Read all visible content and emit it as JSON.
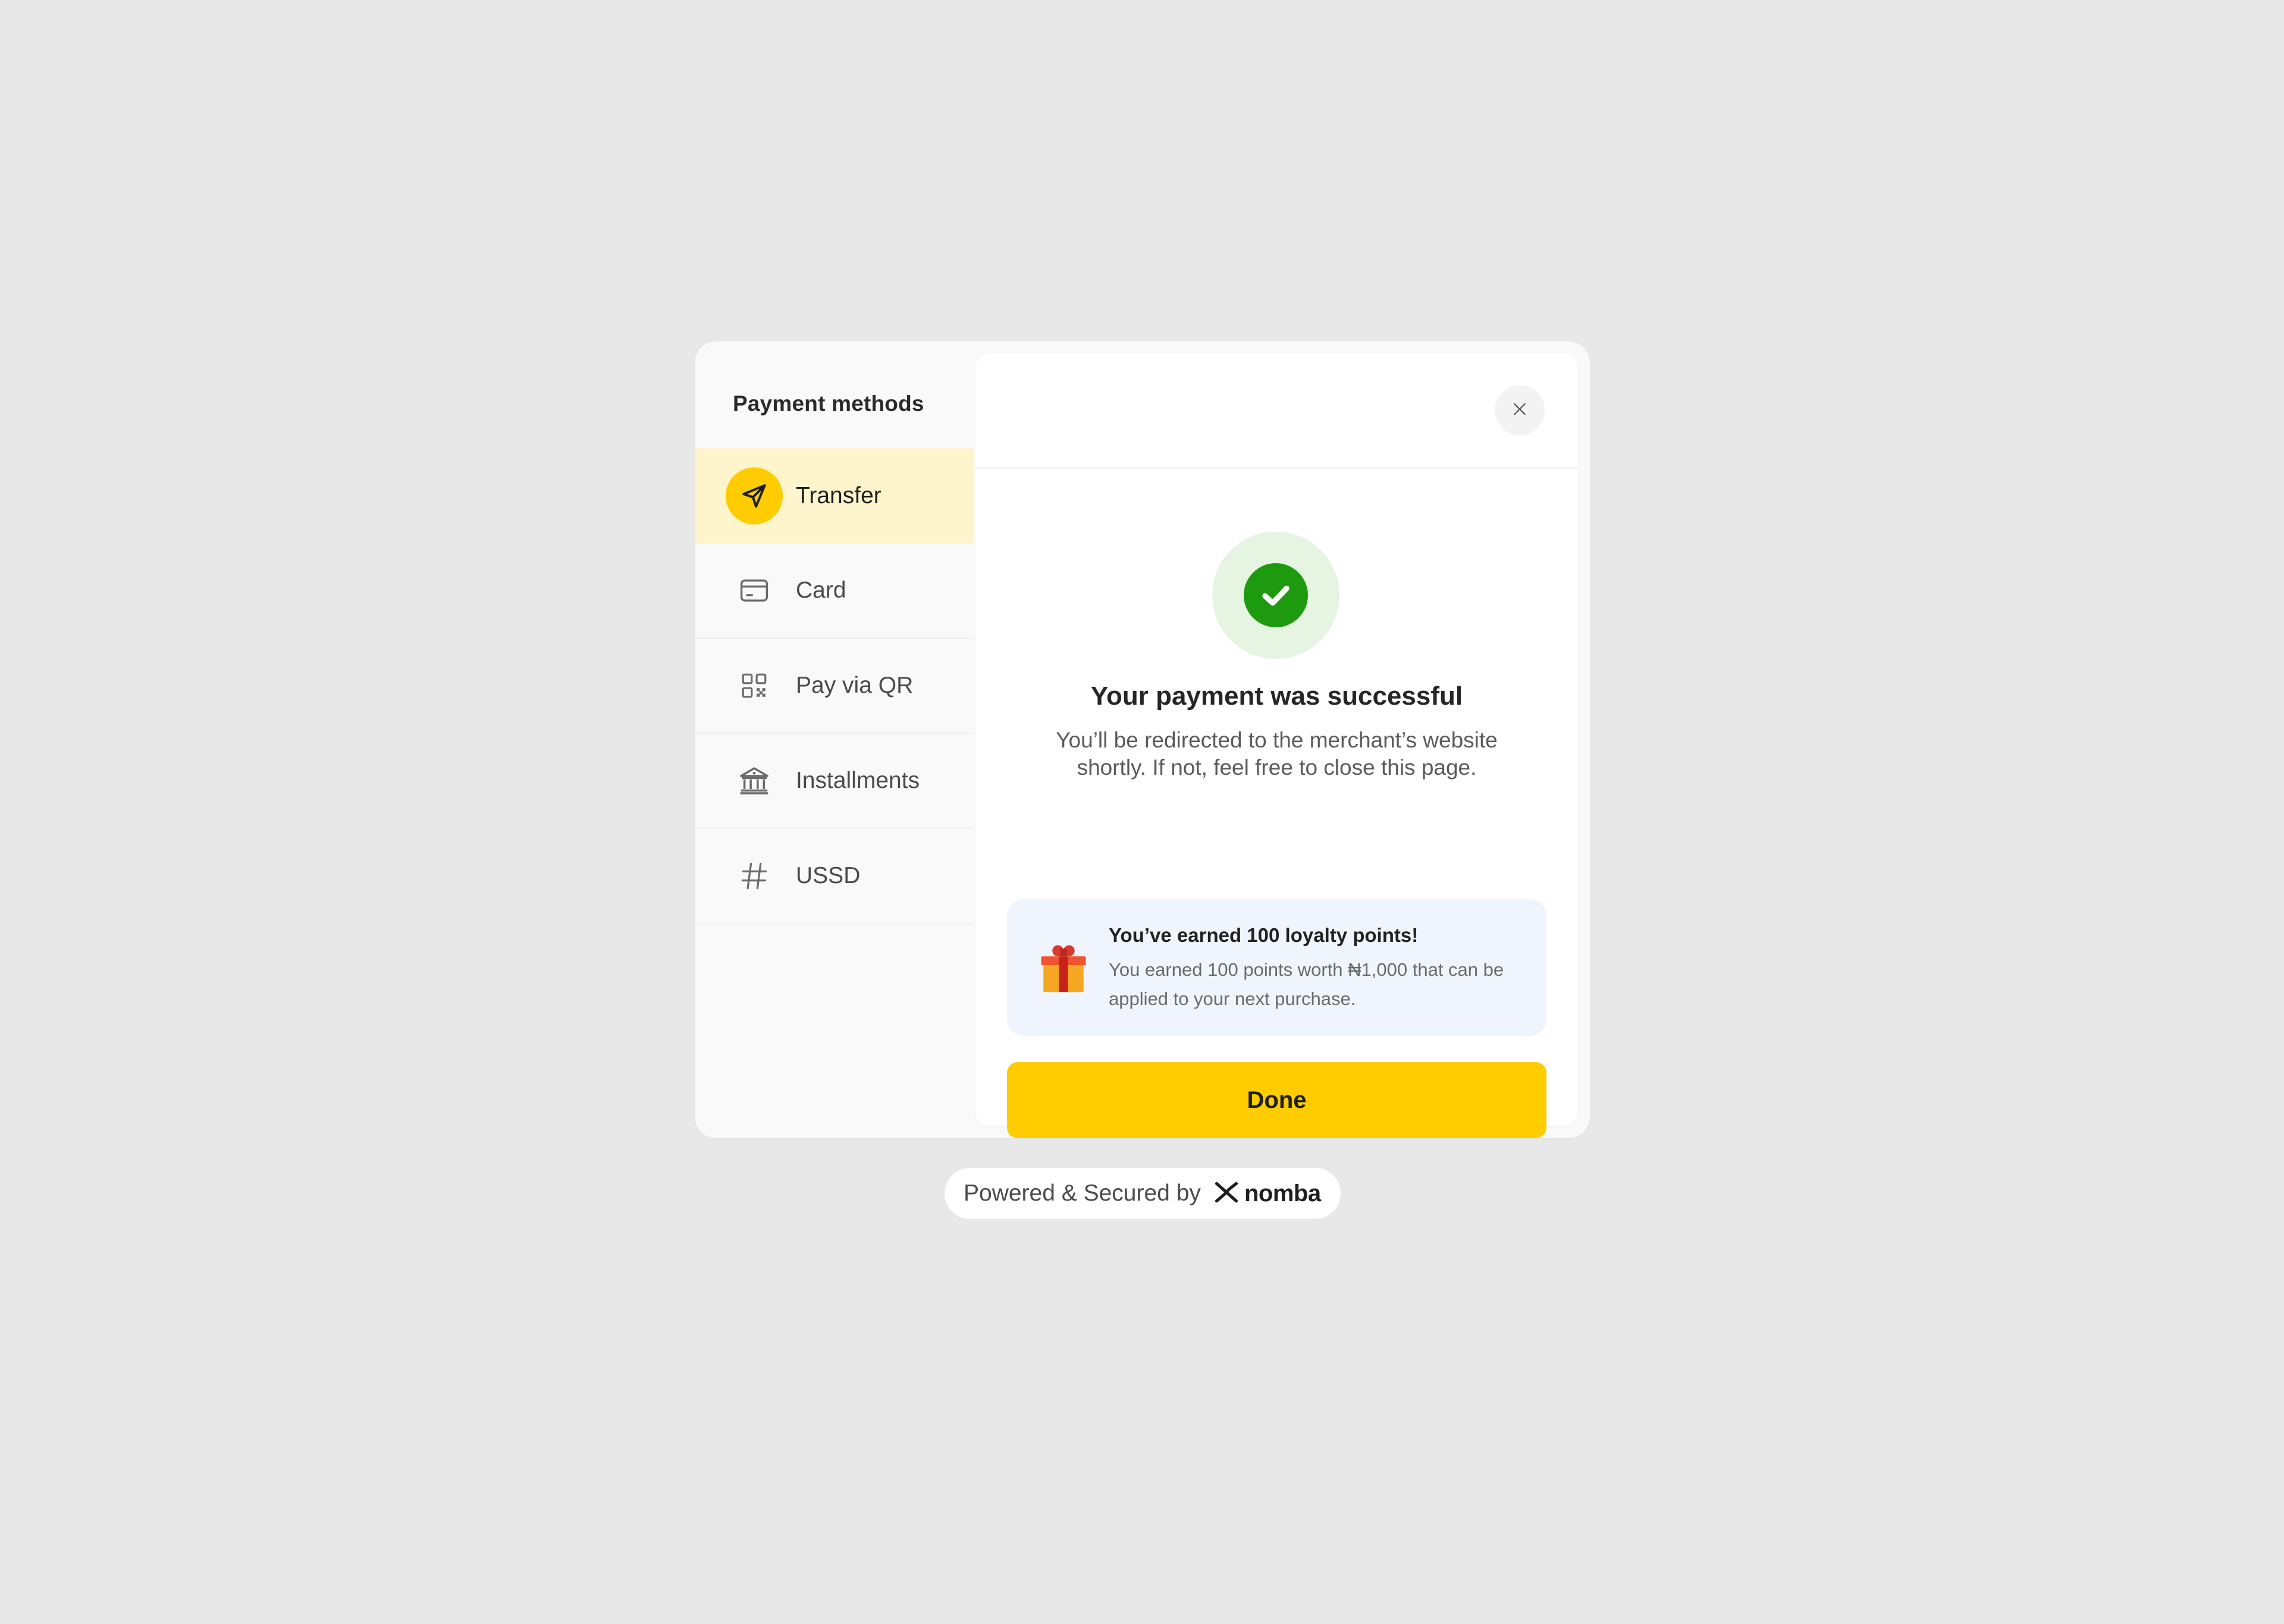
{
  "sidebar": {
    "title": "Payment methods",
    "items": [
      {
        "label": "Transfer",
        "icon": "send-icon",
        "active": true
      },
      {
        "label": "Card",
        "icon": "credit-card-icon",
        "active": false
      },
      {
        "label": "Pay via QR",
        "icon": "qr-code-icon",
        "active": false
      },
      {
        "label": "Installments",
        "icon": "bank-icon",
        "active": false
      },
      {
        "label": "USSD",
        "icon": "hash-icon",
        "active": false
      }
    ]
  },
  "panel": {
    "close_icon": "close-icon",
    "success_icon": "check-circle-icon",
    "title": "Your payment was successful",
    "message": "You’ll be redirected to the merchant’s website shortly. If not, feel free to close this page."
  },
  "loyalty": {
    "icon": "gift-icon",
    "title": "You’ve earned 100 loyalty points!",
    "description": "You earned 100 points worth ₦1,000 that can be applied to your next purchase."
  },
  "done_label": "Done",
  "footer": {
    "text": "Powered & Secured by",
    "brand": "nomba",
    "brand_icon": "nomba-logo-icon"
  },
  "colors": {
    "accent": "#ffcc00",
    "active_bg": "#fff5cc",
    "success": "#1e9a0f",
    "success_bg": "#e6f4e2",
    "loyalty_bg": "#f0f5fd",
    "page_bg": "#e8e8e8"
  }
}
